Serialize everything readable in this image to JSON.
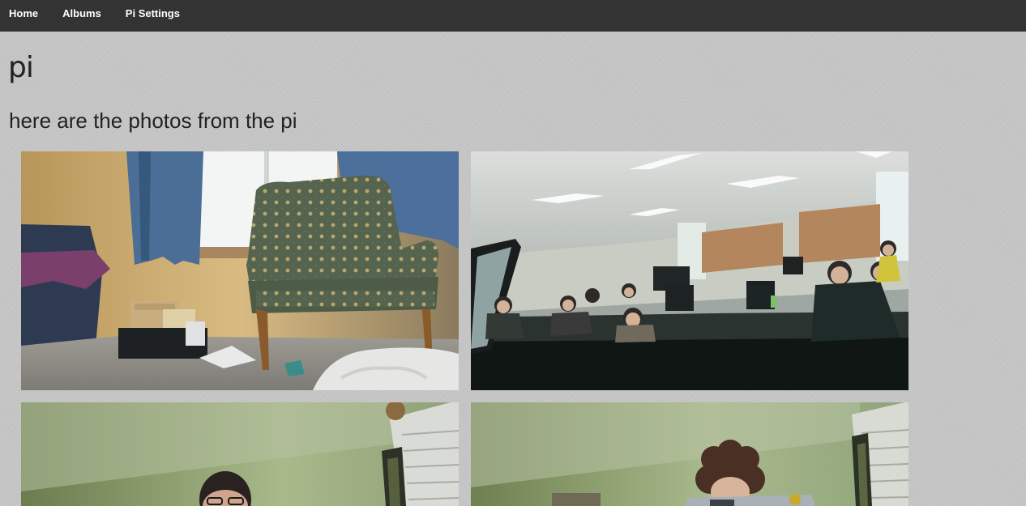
{
  "nav": {
    "items": [
      {
        "label": "Home"
      },
      {
        "label": "Albums"
      },
      {
        "label": "Pi Settings"
      }
    ]
  },
  "page": {
    "title": "pi",
    "subtitle": "here are the photos from the pi"
  },
  "photos": [
    {
      "subject": "living room with green armchair by window"
    },
    {
      "subject": "classroom with people seated at computer desks"
    },
    {
      "subject": "man wearing glasses in green room"
    },
    {
      "subject": "woman with curly hair behind laptop in green room"
    }
  ],
  "colors": {
    "navbar": "#333333",
    "nav_text": "#ffffff",
    "background": "#c6c6c6",
    "text": "#222222"
  }
}
